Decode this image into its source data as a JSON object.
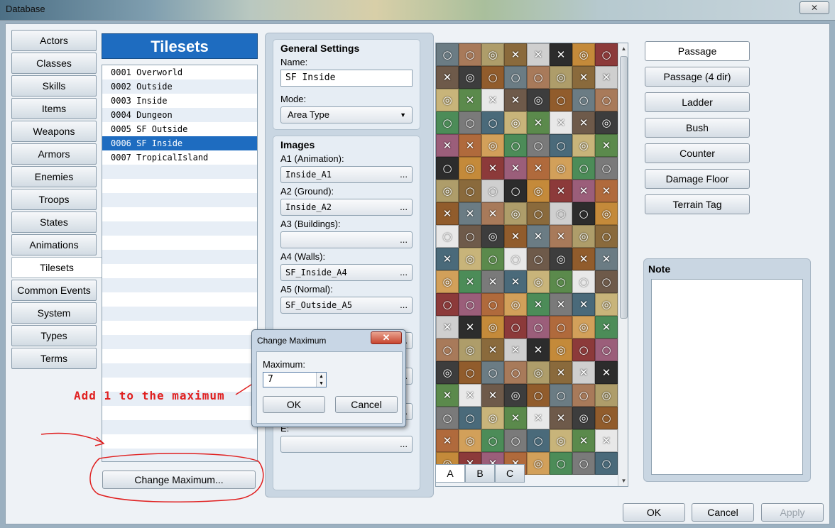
{
  "window": {
    "title": "Database"
  },
  "tabs": [
    "Actors",
    "Classes",
    "Skills",
    "Items",
    "Weapons",
    "Armors",
    "Enemies",
    "Troops",
    "States",
    "Animations",
    "Tilesets",
    "Common Events",
    "System",
    "Types",
    "Terms"
  ],
  "active_tab": "Tilesets",
  "list": {
    "header": "Tilesets",
    "items": [
      "0001 Overworld",
      "0002 Outside",
      "0003 Inside",
      "0004 Dungeon",
      "0005 SF Outside",
      "0006 SF Inside",
      "0007 TropicalIsland"
    ],
    "selected_index": 5,
    "change_max_label": "Change Maximum..."
  },
  "general": {
    "title": "General Settings",
    "name_label": "Name:",
    "name_value": "SF Inside",
    "mode_label": "Mode:",
    "mode_value": "Area Type"
  },
  "images": {
    "title": "Images",
    "fields": [
      {
        "label": "A1 (Animation):",
        "value": "Inside_A1"
      },
      {
        "label": "A2 (Ground):",
        "value": "Inside_A2"
      },
      {
        "label": "A3 (Buildings):",
        "value": ""
      },
      {
        "label": "A4 (Walls):",
        "value": "SF_Inside_A4"
      },
      {
        "label": "A5 (Normal):",
        "value": "SF_Outside_A5"
      }
    ],
    "e_label": "E:",
    "e_value": "",
    "browse_label": "..."
  },
  "palette": {
    "tabs": [
      "A",
      "B",
      "C"
    ],
    "active_tab": "A"
  },
  "passage_buttons": [
    "Passage",
    "Passage (4 dir)",
    "Ladder",
    "Bush",
    "Counter",
    "Damage Floor",
    "Terrain Tag"
  ],
  "note": {
    "title": "Note",
    "value": ""
  },
  "footer": {
    "ok": "OK",
    "cancel": "Cancel",
    "apply": "Apply"
  },
  "dialog": {
    "title": "Change Maximum",
    "close": "✕",
    "maximum_label": "Maximum:",
    "maximum_value": "7",
    "ok": "OK",
    "cancel": "Cancel"
  },
  "annotation": {
    "text": "Add 1 to the maximum",
    "color": "#e02020"
  },
  "colors": {
    "accent": "#1e6cc0"
  }
}
